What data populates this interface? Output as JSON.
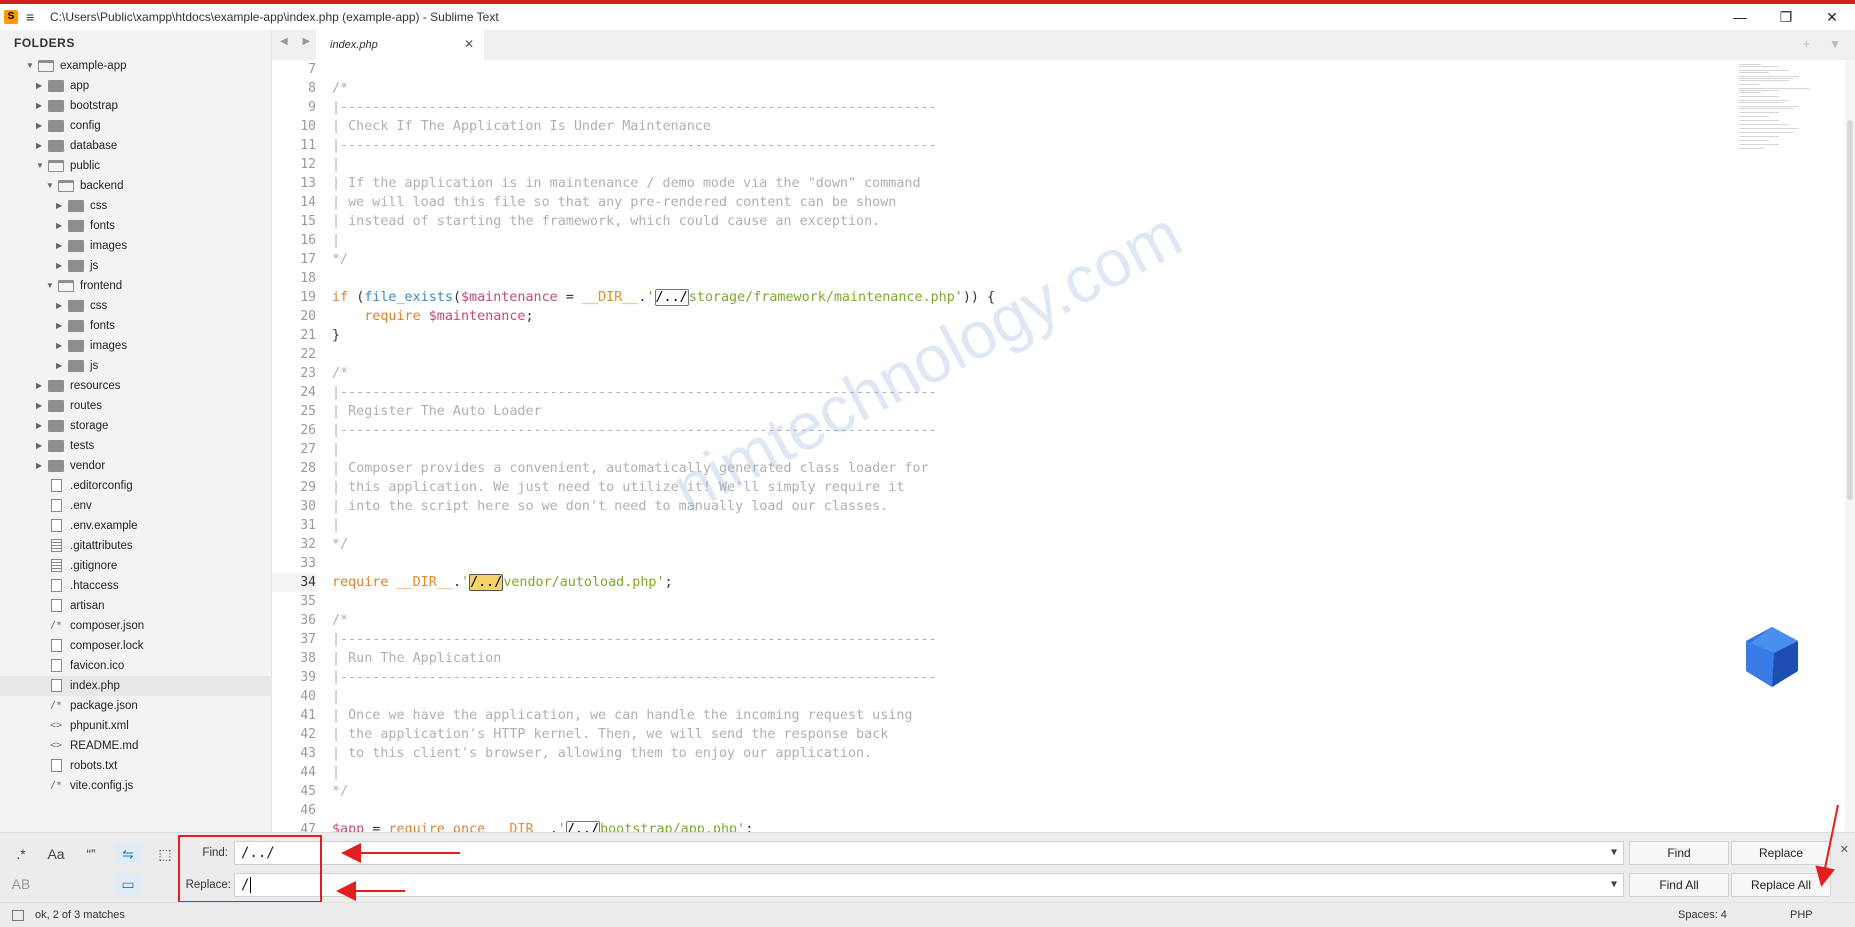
{
  "window": {
    "title": "C:\\Users\\Public\\xampp\\htdocs\\example-app\\index.php (example-app) - Sublime Text",
    "minimize": "—",
    "maximize": "❐",
    "close": "✕",
    "accent": "#d0201c"
  },
  "sidebar": {
    "header": "FOLDERS",
    "items": [
      {
        "label": "example-app",
        "kind": "folder-open",
        "depth": 0,
        "expanded": true
      },
      {
        "label": "app",
        "kind": "folder",
        "depth": 1
      },
      {
        "label": "bootstrap",
        "kind": "folder",
        "depth": 1
      },
      {
        "label": "config",
        "kind": "folder",
        "depth": 1
      },
      {
        "label": "database",
        "kind": "folder",
        "depth": 1
      },
      {
        "label": "public",
        "kind": "folder-open",
        "depth": 1,
        "expanded": true
      },
      {
        "label": "backend",
        "kind": "folder-open",
        "depth": 2,
        "expanded": true
      },
      {
        "label": "css",
        "kind": "folder",
        "depth": 3
      },
      {
        "label": "fonts",
        "kind": "folder",
        "depth": 3
      },
      {
        "label": "images",
        "kind": "folder",
        "depth": 3
      },
      {
        "label": "js",
        "kind": "folder",
        "depth": 3
      },
      {
        "label": "frontend",
        "kind": "folder-open",
        "depth": 2,
        "expanded": true
      },
      {
        "label": "css",
        "kind": "folder",
        "depth": 3
      },
      {
        "label": "fonts",
        "kind": "folder",
        "depth": 3
      },
      {
        "label": "images",
        "kind": "folder",
        "depth": 3
      },
      {
        "label": "js",
        "kind": "folder",
        "depth": 3
      },
      {
        "label": "resources",
        "kind": "folder",
        "depth": 1
      },
      {
        "label": "routes",
        "kind": "folder",
        "depth": 1
      },
      {
        "label": "storage",
        "kind": "folder",
        "depth": 1
      },
      {
        "label": "tests",
        "kind": "folder",
        "depth": 1
      },
      {
        "label": "vendor",
        "kind": "folder",
        "depth": 1
      },
      {
        "label": ".editorconfig",
        "kind": "file",
        "depth": 1
      },
      {
        "label": ".env",
        "kind": "file",
        "depth": 1
      },
      {
        "label": ".env.example",
        "kind": "file",
        "depth": 1
      },
      {
        "label": ".gitattributes",
        "kind": "file-lines",
        "depth": 1
      },
      {
        "label": ".gitignore",
        "kind": "file-lines",
        "depth": 1
      },
      {
        "label": ".htaccess",
        "kind": "file",
        "depth": 1
      },
      {
        "label": "artisan",
        "kind": "file",
        "depth": 1
      },
      {
        "label": "composer.json",
        "kind": "file-json",
        "depth": 1
      },
      {
        "label": "composer.lock",
        "kind": "file",
        "depth": 1
      },
      {
        "label": "favicon.ico",
        "kind": "file",
        "depth": 1
      },
      {
        "label": "index.php",
        "kind": "file",
        "depth": 1,
        "selected": true
      },
      {
        "label": "package.json",
        "kind": "file-json",
        "depth": 1
      },
      {
        "label": "phpunit.xml",
        "kind": "file-xml",
        "depth": 1
      },
      {
        "label": "README.md",
        "kind": "file-xml",
        "depth": 1
      },
      {
        "label": "robots.txt",
        "kind": "file",
        "depth": 1
      },
      {
        "label": "vite.config.js",
        "kind": "file-json",
        "depth": 1
      }
    ]
  },
  "tabs": [
    {
      "label": "index.php",
      "active": true,
      "close": "✕"
    }
  ],
  "tabbar": {
    "nav": "◀ ▶",
    "right": "+ ▼"
  },
  "editor": {
    "current_line": 34,
    "lines": [
      {
        "n": 7,
        "t": [
          [
            "pl",
            ""
          ]
        ]
      },
      {
        "n": 8,
        "t": [
          [
            "cm",
            "/*"
          ]
        ]
      },
      {
        "n": 9,
        "t": [
          [
            "cm",
            "|--------------------------------------------------------------------------"
          ]
        ]
      },
      {
        "n": 10,
        "t": [
          [
            "cm",
            "| Check If The Application Is Under Maintenance"
          ]
        ]
      },
      {
        "n": 11,
        "t": [
          [
            "cm",
            "|--------------------------------------------------------------------------"
          ]
        ]
      },
      {
        "n": 12,
        "t": [
          [
            "cm",
            "|"
          ]
        ]
      },
      {
        "n": 13,
        "t": [
          [
            "cm",
            "| If the application is in maintenance / demo mode via the \"down\" command"
          ]
        ]
      },
      {
        "n": 14,
        "t": [
          [
            "cm",
            "| we will load this file so that any pre-rendered content can be shown"
          ]
        ]
      },
      {
        "n": 15,
        "t": [
          [
            "cm",
            "| instead of starting the framework, which could cause an exception."
          ]
        ]
      },
      {
        "n": 16,
        "t": [
          [
            "cm",
            "|"
          ]
        ]
      },
      {
        "n": 17,
        "t": [
          [
            "cm",
            "*/"
          ]
        ]
      },
      {
        "n": 18,
        "t": [
          [
            "pl",
            ""
          ]
        ]
      },
      {
        "n": 19,
        "t": [
          [
            "kw",
            "if "
          ],
          [
            "pl",
            "("
          ],
          [
            "fn",
            "file_exists"
          ],
          [
            "pl",
            "("
          ],
          [
            "var",
            "$maintenance"
          ],
          [
            "pl",
            " = "
          ],
          [
            "cn",
            "__DIR__"
          ],
          [
            "pl",
            "."
          ],
          [
            "str",
            "'"
          ],
          [
            "match",
            "/../"
          ],
          [
            "str",
            "storage/framework/maintenance.php'"
          ],
          [
            "pl",
            "))"
          ],
          [
            "pl",
            " {"
          ]
        ]
      },
      {
        "n": 20,
        "t": [
          [
            "pl",
            "    "
          ],
          [
            "kw",
            "require "
          ],
          [
            "var",
            "$maintenance"
          ],
          [
            "pl",
            ";"
          ]
        ]
      },
      {
        "n": 21,
        "t": [
          [
            "pl",
            "}"
          ]
        ]
      },
      {
        "n": 22,
        "t": [
          [
            "pl",
            ""
          ]
        ]
      },
      {
        "n": 23,
        "t": [
          [
            "cm",
            "/*"
          ]
        ]
      },
      {
        "n": 24,
        "t": [
          [
            "cm",
            "|--------------------------------------------------------------------------"
          ]
        ]
      },
      {
        "n": 25,
        "t": [
          [
            "cm",
            "| Register The Auto Loader"
          ]
        ]
      },
      {
        "n": 26,
        "t": [
          [
            "cm",
            "|--------------------------------------------------------------------------"
          ]
        ]
      },
      {
        "n": 27,
        "t": [
          [
            "cm",
            "|"
          ]
        ]
      },
      {
        "n": 28,
        "t": [
          [
            "cm",
            "| Composer provides a convenient, automatically generated class loader for"
          ]
        ]
      },
      {
        "n": 29,
        "t": [
          [
            "cm",
            "| this application. We just need to utilize it! We'll simply require it"
          ]
        ]
      },
      {
        "n": 30,
        "t": [
          [
            "cm",
            "| into the script here so we don't need to manually load our classes."
          ]
        ]
      },
      {
        "n": 31,
        "t": [
          [
            "cm",
            "|"
          ]
        ]
      },
      {
        "n": 32,
        "t": [
          [
            "cm",
            "*/"
          ]
        ]
      },
      {
        "n": 33,
        "t": [
          [
            "pl",
            ""
          ]
        ]
      },
      {
        "n": 34,
        "t": [
          [
            "kw",
            "require "
          ],
          [
            "cn",
            "__DIR__"
          ],
          [
            "pl",
            "."
          ],
          [
            "str",
            "'"
          ],
          [
            "match-active",
            "/../"
          ],
          [
            "str",
            "vendor/autoload.php'"
          ],
          [
            "pl",
            ";"
          ]
        ]
      },
      {
        "n": 35,
        "t": [
          [
            "pl",
            ""
          ]
        ]
      },
      {
        "n": 36,
        "t": [
          [
            "cm",
            "/*"
          ]
        ]
      },
      {
        "n": 37,
        "t": [
          [
            "cm",
            "|--------------------------------------------------------------------------"
          ]
        ]
      },
      {
        "n": 38,
        "t": [
          [
            "cm",
            "| Run The Application"
          ]
        ]
      },
      {
        "n": 39,
        "t": [
          [
            "cm",
            "|--------------------------------------------------------------------------"
          ]
        ]
      },
      {
        "n": 40,
        "t": [
          [
            "cm",
            "|"
          ]
        ]
      },
      {
        "n": 41,
        "t": [
          [
            "cm",
            "| Once we have the application, we can handle the incoming request using"
          ]
        ]
      },
      {
        "n": 42,
        "t": [
          [
            "cm",
            "| the application's HTTP kernel. Then, we will send the response back"
          ]
        ]
      },
      {
        "n": 43,
        "t": [
          [
            "cm",
            "| to this client's browser, allowing them to enjoy our application."
          ]
        ]
      },
      {
        "n": 44,
        "t": [
          [
            "cm",
            "|"
          ]
        ]
      },
      {
        "n": 45,
        "t": [
          [
            "cm",
            "*/"
          ]
        ]
      },
      {
        "n": 46,
        "t": [
          [
            "pl",
            ""
          ]
        ]
      },
      {
        "n": 47,
        "t": [
          [
            "var",
            "$app"
          ],
          [
            "pl",
            " = "
          ],
          [
            "kw",
            "require_once "
          ],
          [
            "cn",
            "__DIR__"
          ],
          [
            "pl",
            "."
          ],
          [
            "str",
            "'"
          ],
          [
            "match",
            "/../"
          ],
          [
            "str",
            "bootstrap/app.php'"
          ],
          [
            "pl",
            ";"
          ]
        ]
      }
    ]
  },
  "watermark": "nimtechnology.com",
  "find_panel": {
    "toggles": [
      ".*",
      "Aa",
      "“”",
      "⇋",
      "⬚",
      "AB",
      "▭"
    ],
    "find_label": "Find:",
    "find_value": "/../",
    "replace_label": "Replace:",
    "replace_value": "/",
    "dropdown": "▼",
    "find_button": "Find",
    "replace_button": "Replace",
    "find_all_button": "Find All",
    "replace_all_button": "Replace All",
    "close": "✕",
    "annotation_color": "#e41e1e"
  },
  "status": {
    "message": "ok, 2 of 3 matches",
    "spaces": "Spaces: 4",
    "syntax": "PHP"
  }
}
